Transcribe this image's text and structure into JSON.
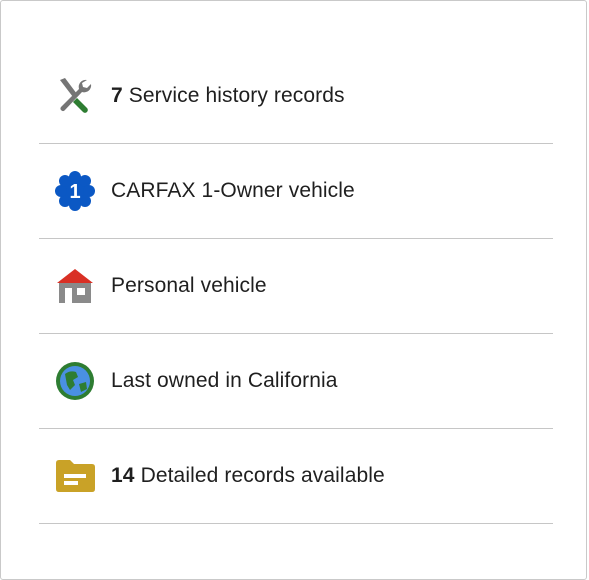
{
  "history_items": [
    {
      "count": "7",
      "label": "Service history records",
      "icon": "tools-icon"
    },
    {
      "count": "",
      "label": "CARFAX 1-Owner vehicle",
      "icon": "one-owner-badge-icon",
      "badge_text": "1"
    },
    {
      "count": "",
      "label": "Personal vehicle",
      "icon": "house-icon"
    },
    {
      "count": "",
      "label": "Last owned in California",
      "icon": "globe-icon"
    },
    {
      "count": "14",
      "label": "Detailed records available",
      "icon": "folder-icon"
    }
  ],
  "colors": {
    "tools_gray": "#757575",
    "tools_green": "#2e7d32",
    "badge_blue": "#0b58c4",
    "house_red": "#d93025",
    "house_gray": "#8a8a8a",
    "globe_green": "#2e7d32",
    "globe_blue": "#4a90e2",
    "folder_gold": "#c9a227",
    "divider": "#c6c6c6"
  }
}
